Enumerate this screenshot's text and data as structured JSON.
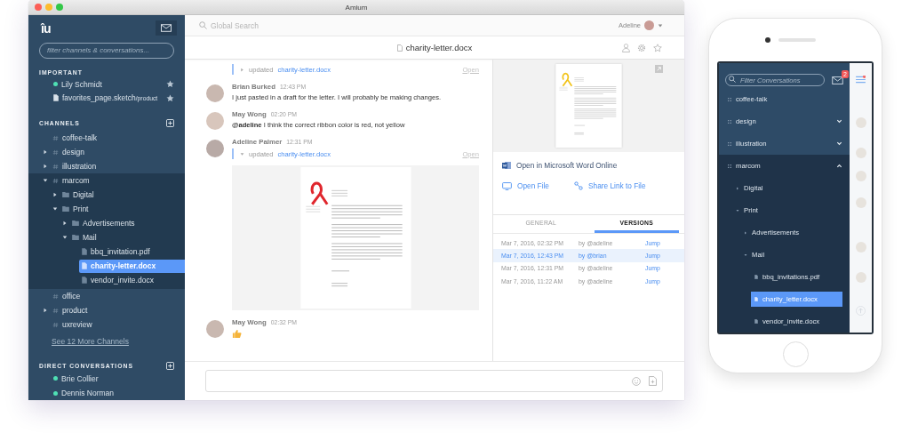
{
  "window": {
    "title": "Amium"
  },
  "sidebar": {
    "logo": "îu",
    "filter": {
      "placeholder": "filter channels & conversations..."
    },
    "important": {
      "heading": "IMPORTANT",
      "items": [
        {
          "kind": "person",
          "label": "Lily Schmidt",
          "online": true,
          "starred": true
        },
        {
          "kind": "file",
          "label": "favorites_page.sketch",
          "context": "/product",
          "starred": true
        }
      ]
    },
    "channels": {
      "heading": "CHANNELS",
      "items": [
        {
          "kind": "channel",
          "label": "coffee-talk",
          "selected": false
        },
        {
          "kind": "channel",
          "label": "design",
          "expanded": false,
          "selected": false
        },
        {
          "kind": "channel",
          "label": "illustration",
          "expanded": false,
          "selected": false
        },
        {
          "kind": "channel",
          "label": "marcom",
          "expanded": true,
          "selected": false,
          "children": [
            {
              "kind": "folder",
              "label": "Digital",
              "expanded": false,
              "selected": false
            },
            {
              "kind": "folder",
              "label": "Print",
              "expanded": true,
              "selected": false,
              "children": [
                {
                  "kind": "folder",
                  "label": "Advertisements",
                  "expanded": false,
                  "selected": false
                },
                {
                  "kind": "folder",
                  "label": "Mail",
                  "expanded": true,
                  "selected": false,
                  "children": [
                    {
                      "kind": "file",
                      "label": "bbq_invitation.pdf",
                      "selected": false
                    },
                    {
                      "kind": "file",
                      "label": "charity-letter.docx",
                      "selected": true
                    },
                    {
                      "kind": "file",
                      "label": "vendor_invite.docx",
                      "selected": false
                    }
                  ]
                }
              ]
            }
          ]
        },
        {
          "kind": "channel",
          "label": "office",
          "selected": false
        },
        {
          "kind": "channel",
          "label": "product",
          "expanded": false,
          "selected": false
        },
        {
          "kind": "channel",
          "label": "uxreview",
          "selected": false
        }
      ],
      "more_link": "See 12 More Channels"
    },
    "direct": {
      "heading": "DIRECT CONVERSATIONS",
      "items": [
        {
          "label": "Brie Collier",
          "online": true
        },
        {
          "label": "Dennis Norman",
          "online": true
        }
      ]
    }
  },
  "topbar": {
    "search": {
      "placeholder": "Global Search"
    },
    "user": "Adeline"
  },
  "document": {
    "title": "charity-letter.docx"
  },
  "messages": [
    {
      "kind": "update",
      "verb": "updated",
      "file": "charity-letter.docx",
      "action": "Open",
      "expanded": false
    },
    {
      "kind": "text",
      "author": "Brian Burked",
      "time": "12:43 PM",
      "text": "I just pasted in a draft for the letter. I will probably be making changes."
    },
    {
      "kind": "text",
      "author": "May Wong",
      "time": "02:20 PM",
      "text": "**@adeline** I think the correct ribbon color is red, not yellow"
    },
    {
      "kind": "update",
      "author": "Adeline Palmer",
      "time": "12:31 PM",
      "verb": "updated",
      "file": "charity-letter.docx",
      "action": "Open",
      "expanded": true
    },
    {
      "kind": "thumbs_up",
      "author": "May Wong",
      "time": "02:32 PM"
    }
  ],
  "detail": {
    "open_online": "Open in Microsoft Word Online",
    "open_file": "Open File",
    "share": "Share Link to File",
    "tabs": [
      {
        "label": "GENERAL",
        "selected": false
      },
      {
        "label": "VERSIONS",
        "selected": true
      }
    ],
    "versions": [
      {
        "date": "Mar 7, 2016, 02:32 PM",
        "by": "by @adeline",
        "action": "Jump",
        "selected": false
      },
      {
        "date": "Mar 7, 2016, 12:43 PM",
        "by": "by @brian",
        "action": "Jump",
        "selected": true
      },
      {
        "date": "Mar 7, 2016, 12:31 PM",
        "by": "by @adeline",
        "action": "Jump",
        "selected": false
      },
      {
        "date": "Mar 7, 2016, 11:22 AM",
        "by": "by @adeline",
        "action": "Jump",
        "selected": false
      }
    ]
  },
  "phone": {
    "filter": {
      "placeholder": "Filter Conversations"
    },
    "unread": "2",
    "items": [
      {
        "kind": "channel",
        "label": "coffee-talk",
        "selected": false
      },
      {
        "kind": "channel",
        "label": "design",
        "expanded": false,
        "selected": false
      },
      {
        "kind": "channel",
        "label": "illustration",
        "expanded": false,
        "selected": false
      },
      {
        "kind": "channel",
        "label": "marcom",
        "expanded": true,
        "selected": false,
        "children": [
          {
            "kind": "folder",
            "label": "Digital",
            "expanded": false,
            "selected": false
          },
          {
            "kind": "folder",
            "label": "Print",
            "expanded": true,
            "selected": false,
            "children": [
              {
                "kind": "folder",
                "label": "Advertisements",
                "expanded": false,
                "selected": false
              },
              {
                "kind": "folder",
                "label": "Mail",
                "expanded": true,
                "selected": false,
                "children": [
                  {
                    "kind": "file",
                    "label": "bbq_invitations.pdf",
                    "selected": false
                  },
                  {
                    "kind": "file",
                    "label": "charity_letter.docx",
                    "selected": true
                  },
                  {
                    "kind": "file",
                    "label": "vendor_invite.docx",
                    "selected": false
                  }
                ]
              }
            ]
          }
        ]
      }
    ]
  }
}
